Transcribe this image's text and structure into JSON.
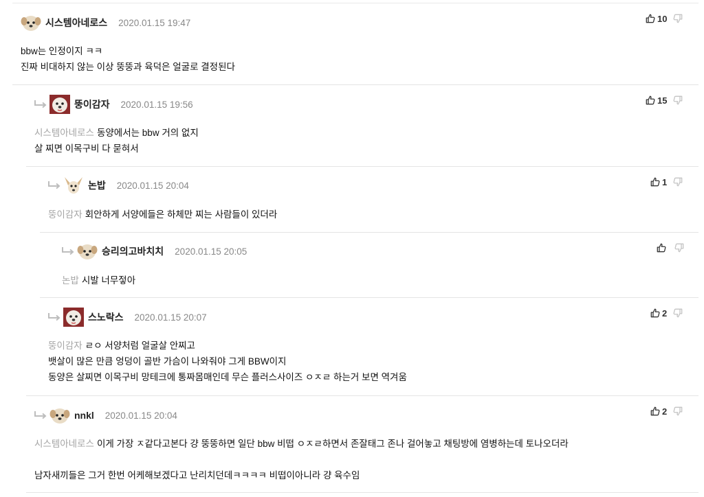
{
  "comments": [
    {
      "nickname": "시스템아네로스",
      "date": "2020.01.15 19:47",
      "likes": "10",
      "mention": "",
      "lines": [
        "bbw는 인정이지 ㅋㅋ",
        "진짜 비대하지 않는 이상 뚱뚱과 육덕은 얼굴로 결정된다"
      ]
    },
    {
      "nickname": "뚱이감자",
      "date": "2020.01.15 19:56",
      "likes": "15",
      "mention": "시스템아네로스",
      "lines": [
        "동양에서는 bbw 거의 없지",
        "살 찌면 이목구비 다 묻혀서"
      ]
    },
    {
      "nickname": "논밥",
      "date": "2020.01.15 20:04",
      "likes": "1",
      "mention": "뚱이감자",
      "lines": [
        "회안하게 서양에들은 하체만 찌는 사람들이 있더라"
      ]
    },
    {
      "nickname": "승리의고바치치",
      "date": "2020.01.15 20:05",
      "likes": "",
      "mention": "논밥",
      "lines": [
        "시발 너무젛아"
      ]
    },
    {
      "nickname": "스노락스",
      "date": "2020.01.15 20:07",
      "likes": "2",
      "mention": "뚱이감자",
      "lines": [
        "ㄹㅇ 서양처럼 얼굴살 안찌고",
        "뱃살이 많은 만큼 엉덩이 골반 가슴이 나와줘야 그게 BBW이지",
        "동양은 살찌면 이목구비 망테크에 통짜몸매인데 무슨 플러스사이즈 ㅇㅈㄹ 하는거 보면 역겨움"
      ]
    },
    {
      "nickname": "nnkl",
      "date": "2020.01.15 20:04",
      "likes": "2",
      "mention": "시스템아네로스",
      "lines": [
        "이게 가장 ㅈ같다고본다 걍 뚱뚱하면 일단 bbw 비떱 ㅇㅈㄹ하면서 존잘태그 존나 걸어놓고 채팅방에 염병하는데 토나오더라",
        "",
        "남자새끼들은 그거 한번 어케해보겠다고 난리치던데ㅋㅋㅋㅋ 비떱이아니라 걍 육수임"
      ]
    }
  ],
  "icons": {
    "like": "thumbs-up-icon",
    "dislike": "thumbs-down-icon",
    "reply": "reply-arrow-icon",
    "avatar": "dog-avatar-icon"
  },
  "colors": {
    "mention": "#a4a4a4",
    "date": "#888888",
    "separator": "#e4e4e4"
  }
}
